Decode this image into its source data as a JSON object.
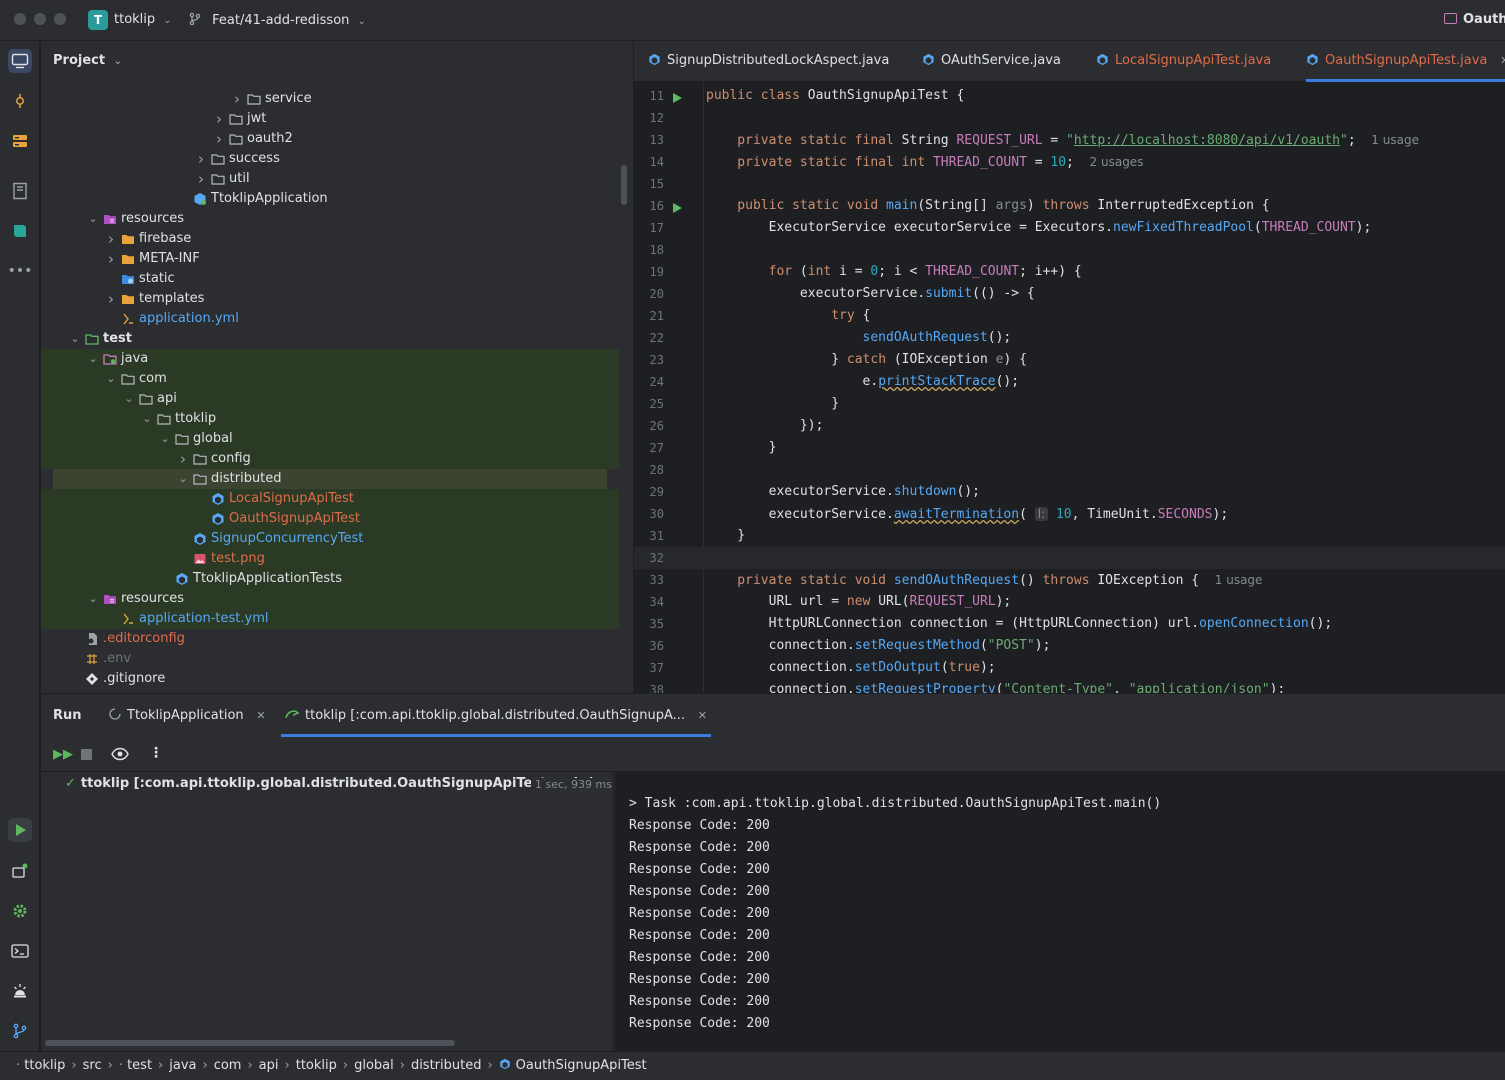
{
  "titlebar": {
    "project_badge": "T",
    "project_name": "ttoklip",
    "branch": "Feat/41-add-redisson",
    "right_title": "OauthS"
  },
  "project_panel": {
    "title": "Project",
    "tree": [
      {
        "label": "service",
        "depth": 11,
        "expanded": false,
        "icon": "package-folder-icon",
        "color": "#dfe1e5"
      },
      {
        "label": "jwt",
        "depth": 10,
        "expanded": false,
        "icon": "package-folder-icon",
        "color": "#dfe1e5"
      },
      {
        "label": "oauth2",
        "depth": 10,
        "expanded": false,
        "icon": "package-folder-icon",
        "color": "#dfe1e5"
      },
      {
        "label": "success",
        "depth": 9,
        "expanded": false,
        "icon": "package-folder-icon",
        "color": "#dfe1e5"
      },
      {
        "label": "util",
        "depth": 9,
        "expanded": false,
        "icon": "package-folder-icon",
        "color": "#dfe1e5"
      },
      {
        "label": "TtoklipApplication",
        "depth": 8,
        "expanded": null,
        "icon": "spring-class-icon",
        "color": "#dfe1e5"
      },
      {
        "label": "resources",
        "depth": 3,
        "expanded": true,
        "icon": "resources-folder-icon",
        "color": "#dfe1e5"
      },
      {
        "label": "firebase",
        "depth": 4,
        "expanded": false,
        "icon": "folder-icon",
        "color": "#dfe1e5"
      },
      {
        "label": "META-INF",
        "depth": 4,
        "expanded": false,
        "icon": "folder-icon",
        "color": "#dfe1e5"
      },
      {
        "label": "static",
        "depth": 4,
        "expanded": null,
        "icon": "web-folder-icon",
        "color": "#dfe1e5"
      },
      {
        "label": "templates",
        "depth": 4,
        "expanded": false,
        "icon": "folder-icon",
        "color": "#dfe1e5"
      },
      {
        "label": "application.yml",
        "depth": 4,
        "expanded": null,
        "icon": "yaml-file-icon",
        "color": "#56a8f5"
      },
      {
        "label": "test",
        "depth": 2,
        "expanded": true,
        "icon": "test-folder-icon",
        "color": "#dfe1e5",
        "bold": true
      },
      {
        "label": "java",
        "depth": 3,
        "expanded": true,
        "icon": "test-source-folder-icon",
        "color": "#dfe1e5"
      },
      {
        "label": "com",
        "depth": 4,
        "expanded": true,
        "icon": "package-folder-icon",
        "color": "#dfe1e5"
      },
      {
        "label": "api",
        "depth": 5,
        "expanded": true,
        "icon": "package-folder-icon",
        "color": "#dfe1e5"
      },
      {
        "label": "ttoklip",
        "depth": 6,
        "expanded": true,
        "icon": "package-folder-icon",
        "color": "#dfe1e5"
      },
      {
        "label": "global",
        "depth": 7,
        "expanded": true,
        "icon": "package-folder-icon",
        "color": "#dfe1e5"
      },
      {
        "label": "config",
        "depth": 8,
        "expanded": false,
        "icon": "package-folder-icon",
        "color": "#dfe1e5"
      },
      {
        "label": "distributed",
        "depth": 8,
        "expanded": true,
        "icon": "package-folder-icon",
        "color": "#dfe1e5",
        "selected": true
      },
      {
        "label": "LocalSignupApiTest",
        "depth": 9,
        "expanded": null,
        "icon": "class-icon",
        "color": "#e06c4b"
      },
      {
        "label": "OauthSignupApiTest",
        "depth": 9,
        "expanded": null,
        "icon": "class-icon",
        "color": "#e06c4b"
      },
      {
        "label": "SignupConcurrencyTest",
        "depth": 8,
        "expanded": null,
        "icon": "class-icon",
        "color": "#56a8f5"
      },
      {
        "label": "test.png",
        "depth": 8,
        "expanded": null,
        "icon": "image-file-icon",
        "color": "#e06c4b"
      },
      {
        "label": "TtoklipApplicationTests",
        "depth": 7,
        "expanded": null,
        "icon": "class-icon",
        "color": "#dfe1e5"
      },
      {
        "label": "resources",
        "depth": 3,
        "expanded": true,
        "icon": "resources-folder-icon",
        "color": "#dfe1e5"
      },
      {
        "label": "application-test.yml",
        "depth": 4,
        "expanded": null,
        "icon": "yaml-file-icon",
        "color": "#56a8f5"
      },
      {
        "label": ".editorconfig",
        "depth": 2,
        "expanded": null,
        "icon": "config-file-icon",
        "color": "#e06c4b"
      },
      {
        "label": ".env",
        "depth": 2,
        "expanded": null,
        "icon": "env-file-icon",
        "color": "#6f737a"
      },
      {
        "label": ".gitignore",
        "depth": 2,
        "expanded": null,
        "icon": "git-file-icon",
        "color": "#dfe1e5"
      }
    ]
  },
  "editor_tabs": [
    {
      "label": "SignupDistributedLockAspect.java",
      "color": "#dfe1e5",
      "active": false
    },
    {
      "label": "OAuthService.java",
      "color": "#dfe1e5",
      "active": false
    },
    {
      "label": "LocalSignupApiTest.java",
      "color": "#e06c4b",
      "active": false
    },
    {
      "label": "OauthSignupApiTest.java",
      "color": "#e06c4b",
      "active": true
    }
  ],
  "editor": {
    "lines": [
      {
        "n": "11",
        "run": true,
        "tokens": [
          [
            "kw",
            "public class "
          ],
          [
            "ty",
            "OauthSignupApiTest {"
          ]
        ]
      },
      {
        "n": "12",
        "tokens": []
      },
      {
        "n": "13",
        "tokens": [
          [
            "kw",
            "    private static final "
          ],
          [
            "ty",
            "String "
          ],
          [
            "cn",
            "REQUEST_URL"
          ],
          [
            "ty",
            " = "
          ],
          [
            "st",
            "\""
          ],
          [
            "stu",
            "http://localhost:8080/api/v1/oauth"
          ],
          [
            "st",
            "\""
          ],
          [
            "ty",
            ";  "
          ],
          [
            "cm",
            "1 usage"
          ]
        ]
      },
      {
        "n": "14",
        "tokens": [
          [
            "kw",
            "    private static final int "
          ],
          [
            "cn",
            "THREAD_COUNT"
          ],
          [
            "ty",
            " = "
          ],
          [
            "nm",
            "10"
          ],
          [
            "ty",
            ";  "
          ],
          [
            "cm",
            "2 usages"
          ]
        ]
      },
      {
        "n": "15",
        "tokens": []
      },
      {
        "n": "16",
        "run": true,
        "tokens": [
          [
            "kw",
            "    public static void "
          ],
          [
            "fn",
            "main"
          ],
          [
            "ty",
            "(String[] "
          ],
          [
            "pm",
            "args"
          ],
          [
            "ty",
            ") "
          ],
          [
            "kw",
            "throws "
          ],
          [
            "ty",
            "InterruptedException {"
          ]
        ]
      },
      {
        "n": "17",
        "tokens": [
          [
            "ty",
            "        ExecutorService executorService = Executors."
          ],
          [
            "fn",
            "newFixedThreadPool"
          ],
          [
            "ty",
            "("
          ],
          [
            "cn",
            "THREAD_COUNT"
          ],
          [
            "ty",
            ");"
          ]
        ]
      },
      {
        "n": "18",
        "tokens": []
      },
      {
        "n": "19",
        "tokens": [
          [
            "kw",
            "        for "
          ],
          [
            "ty",
            "("
          ],
          [
            "kw",
            "int "
          ],
          [
            "ty",
            "i = "
          ],
          [
            "nm",
            "0"
          ],
          [
            "ty",
            "; i < "
          ],
          [
            "cn",
            "THREAD_COUNT"
          ],
          [
            "ty",
            "; i++) {"
          ]
        ]
      },
      {
        "n": "20",
        "tokens": [
          [
            "ty",
            "            executorService."
          ],
          [
            "fn",
            "submit"
          ],
          [
            "ty",
            "(() -> {"
          ]
        ]
      },
      {
        "n": "21",
        "tokens": [
          [
            "kw",
            "                try "
          ],
          [
            "ty",
            "{"
          ]
        ]
      },
      {
        "n": "22",
        "tokens": [
          [
            "fn",
            "                    sendOAuthRequest"
          ],
          [
            "ty",
            "();"
          ]
        ]
      },
      {
        "n": "23",
        "tokens": [
          [
            "ty",
            "                } "
          ],
          [
            "kw",
            "catch "
          ],
          [
            "ty",
            "(IOException "
          ],
          [
            "pm",
            "e"
          ],
          [
            "ty",
            ") {"
          ]
        ]
      },
      {
        "n": "24",
        "tokens": [
          [
            "ty",
            "                    e."
          ],
          [
            "fnu",
            "printStackTrace"
          ],
          [
            "ty",
            "();"
          ]
        ]
      },
      {
        "n": "25",
        "tokens": [
          [
            "ty",
            "                }"
          ]
        ]
      },
      {
        "n": "26",
        "tokens": [
          [
            "ty",
            "            });"
          ]
        ]
      },
      {
        "n": "27",
        "tokens": [
          [
            "ty",
            "        }"
          ]
        ]
      },
      {
        "n": "28",
        "tokens": []
      },
      {
        "n": "29",
        "tokens": [
          [
            "ty",
            "        executorService."
          ],
          [
            "fn",
            "shutdown"
          ],
          [
            "ty",
            "();"
          ]
        ]
      },
      {
        "n": "30",
        "tokens": [
          [
            "ty",
            "        executorService."
          ],
          [
            "fnu",
            "awaitTermination"
          ],
          [
            "ty",
            "( "
          ],
          [
            "cm",
            "l:"
          ],
          [
            "nm",
            " 10"
          ],
          [
            "ty",
            ", TimeUnit."
          ],
          [
            "cn",
            "SECONDS"
          ],
          [
            "ty",
            ");"
          ]
        ]
      },
      {
        "n": "31",
        "tokens": [
          [
            "ty",
            "    }"
          ]
        ]
      },
      {
        "n": "32",
        "current": true,
        "tokens": []
      },
      {
        "n": "33",
        "tokens": [
          [
            "kw",
            "    private static void "
          ],
          [
            "fn",
            "sendOAuthRequest"
          ],
          [
            "ty",
            "() "
          ],
          [
            "kw",
            "throws "
          ],
          [
            "ty",
            "IOException {  "
          ],
          [
            "cm",
            "1 usage"
          ]
        ]
      },
      {
        "n": "34",
        "tokens": [
          [
            "ty",
            "        URL url = "
          ],
          [
            "kw",
            "new "
          ],
          [
            "ty",
            "URL("
          ],
          [
            "cn",
            "REQUEST_URL"
          ],
          [
            "ty",
            ");"
          ]
        ]
      },
      {
        "n": "35",
        "tokens": [
          [
            "ty",
            "        HttpURLConnection connection = (HttpURLConnection) url."
          ],
          [
            "fn",
            "openConnection"
          ],
          [
            "ty",
            "();"
          ]
        ]
      },
      {
        "n": "36",
        "tokens": [
          [
            "ty",
            "        connection."
          ],
          [
            "fn",
            "setRequestMethod"
          ],
          [
            "ty",
            "("
          ],
          [
            "st",
            "\"POST\""
          ],
          [
            "ty",
            ");"
          ]
        ]
      },
      {
        "n": "37",
        "tokens": [
          [
            "ty",
            "        connection."
          ],
          [
            "fn",
            "setDoOutput"
          ],
          [
            "ty",
            "("
          ],
          [
            "kw",
            "true"
          ],
          [
            "ty",
            ");"
          ]
        ]
      },
      {
        "n": "38",
        "tokens": [
          [
            "ty",
            "        connection."
          ],
          [
            "fn",
            "setRequestProperty"
          ],
          [
            "ty",
            "("
          ],
          [
            "st",
            "\"Content-Type\""
          ],
          [
            "ty",
            ", "
          ],
          [
            "st",
            "\"application/json\""
          ],
          [
            "ty",
            ");"
          ]
        ]
      }
    ]
  },
  "run_panel": {
    "title": "Run",
    "tabs": [
      {
        "label": "TtoklipApplication",
        "active": false
      },
      {
        "label": "ttoklip [:com.api.ttoklip.global.distributed.OauthSignupA...",
        "active": true
      }
    ],
    "tree_item": "ttoklip [:com.api.ttoklip.global.distributed.OauthSignupApiTest.main(",
    "tree_time": "1 sec, 939 ms",
    "console": [
      "> Task :com.api.ttoklip.global.distributed.OauthSignupApiTest.main()",
      "Response Code: 200",
      "Response Code: 200",
      "Response Code: 200",
      "Response Code: 200",
      "Response Code: 200",
      "Response Code: 200",
      "Response Code: 200",
      "Response Code: 200",
      "Response Code: 200",
      "Response Code: 200"
    ]
  },
  "statusbar": {
    "crumbs": [
      "ttoklip",
      "src",
      "test",
      "java",
      "com",
      "api",
      "ttoklip",
      "global",
      "distributed",
      "OauthSignupApiTest"
    ]
  }
}
